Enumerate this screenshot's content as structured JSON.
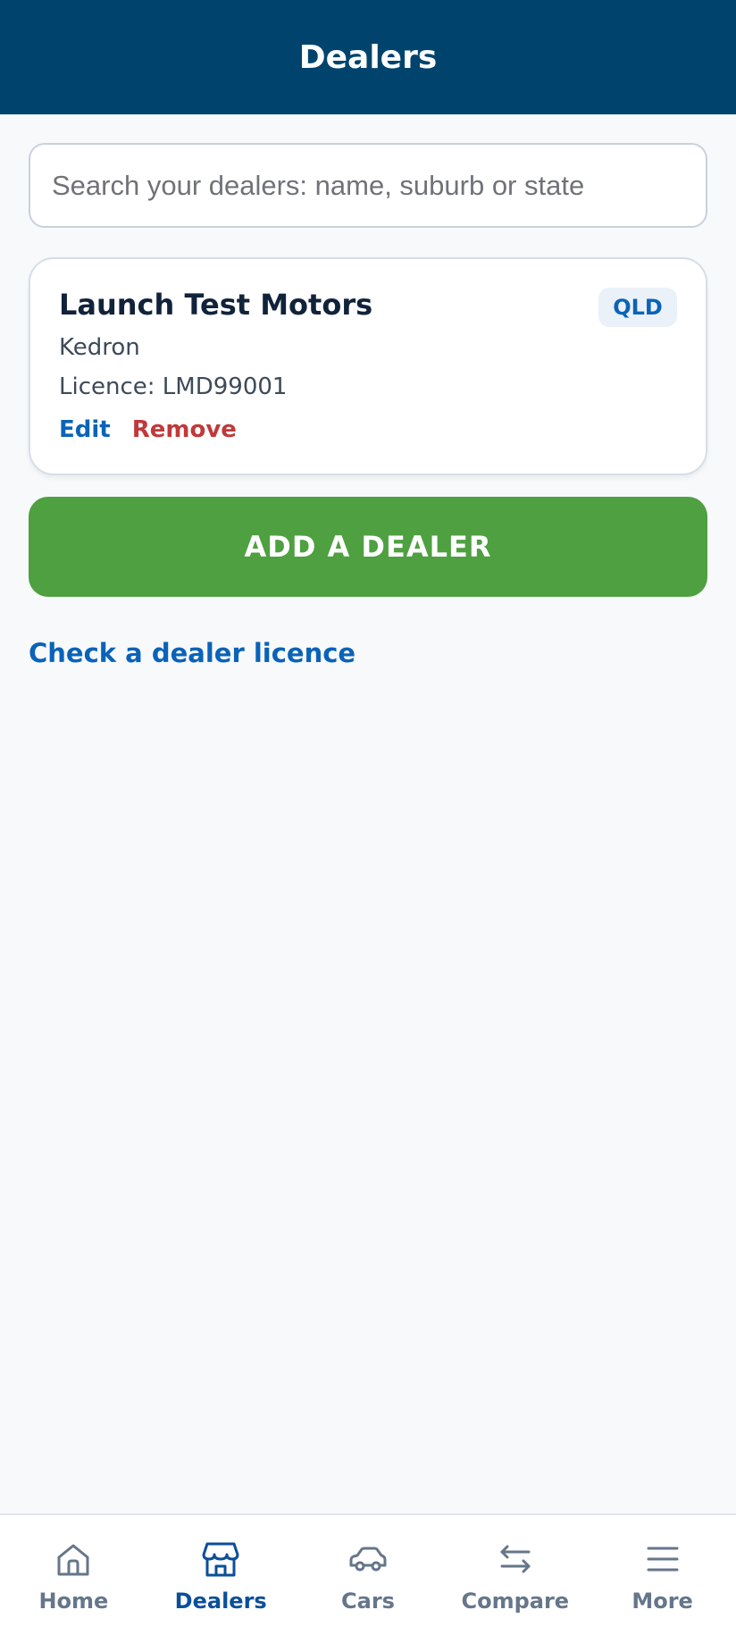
{
  "header": {
    "title": "Dealers"
  },
  "search": {
    "placeholder": "Search your dealers: name, suburb or state",
    "value": ""
  },
  "dealers": [
    {
      "name": "Launch Test Motors",
      "state": "QLD",
      "suburb": "Kedron",
      "licence": "Licence: LMD99001",
      "edit_label": "Edit",
      "remove_label": "Remove"
    }
  ],
  "actions": {
    "add_label": "ADD A DEALER",
    "check_licence_label": "Check a dealer licence"
  },
  "nav": {
    "items": [
      {
        "label": "Home",
        "icon": "home-icon",
        "active": false
      },
      {
        "label": "Dealers",
        "icon": "store-icon",
        "active": true
      },
      {
        "label": "Cars",
        "icon": "car-icon",
        "active": false
      },
      {
        "label": "Compare",
        "icon": "swap-arrows-icon",
        "active": false
      },
      {
        "label": "More",
        "icon": "menu-icon",
        "active": false
      }
    ]
  },
  "colors": {
    "header_bg": "#00446e",
    "primary_link": "#0a63b8",
    "danger": "#c0393b",
    "add_button": "#4ea040",
    "nav_active": "#0a4f9a",
    "nav_inactive": "#66768a"
  }
}
